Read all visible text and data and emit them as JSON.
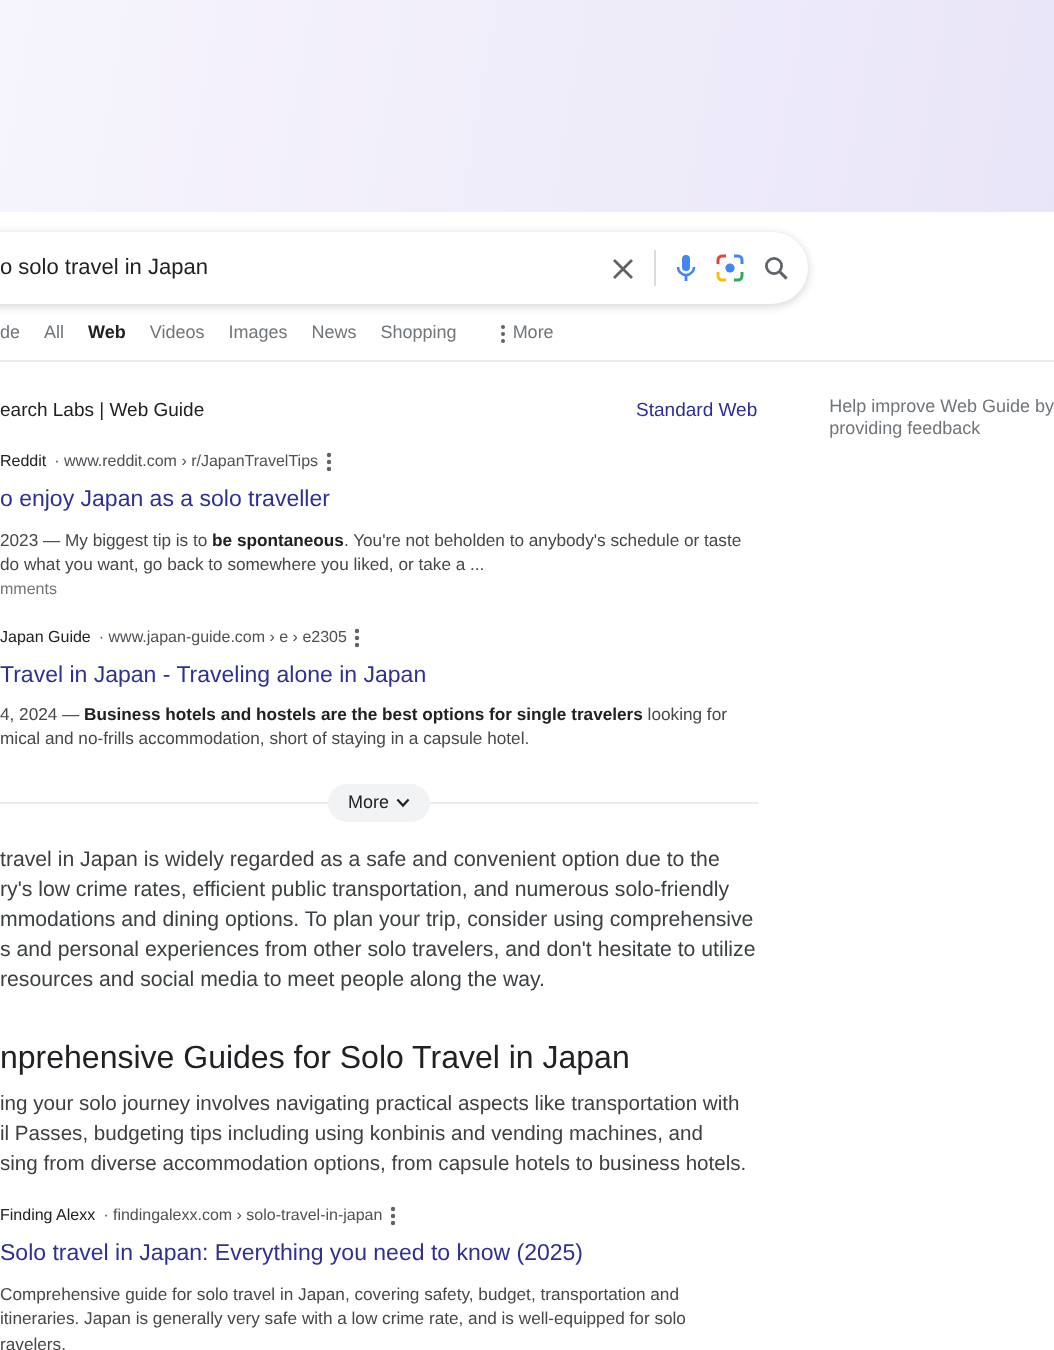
{
  "search": {
    "value": "o solo travel in Japan"
  },
  "tabs": [
    {
      "label": "de",
      "selected": false,
      "kind": "plain"
    },
    {
      "label": "All",
      "selected": false,
      "kind": "plain"
    },
    {
      "label": "Web",
      "selected": true,
      "kind": "plain"
    },
    {
      "label": "Videos",
      "selected": false,
      "kind": "plain"
    },
    {
      "label": "Images",
      "selected": false,
      "kind": "plain"
    },
    {
      "label": "News",
      "selected": false,
      "kind": "plain"
    },
    {
      "label": "Shopping",
      "selected": false,
      "kind": "plain"
    },
    {
      "label": "More",
      "selected": false,
      "kind": "menu"
    }
  ],
  "guide_header": {
    "title": "earch Labs | Web Guide",
    "link": "Standard Web",
    "feedback_lines": [
      "Help improve Web Guide by",
      "providing feedback"
    ]
  },
  "results": [
    {
      "site": "Reddit",
      "url": "· www.reddit.com › r/JapanTravelTips",
      "title": "o enjoy Japan as a solo traveller",
      "snippet_lines": [
        "2023 — My biggest tip is to **be spontaneous**. You're not beholden to anybody's schedule or taste",
        "do what you want, go back to somewhere you liked, or take a ..."
      ],
      "footer": "mments"
    },
    {
      "site": "Japan Guide",
      "url": "· www.japan-guide.com › e › e2305",
      "title": "Travel in Japan - Traveling alone in Japan",
      "snippet_lines": [
        "4, 2024 — **Business hotels and hostels are the best options for single travelers** looking for",
        "mical and no-frills accommodation, short of staying in a capsule hotel."
      ]
    }
  ],
  "more_button": {
    "label": "More"
  },
  "summary_lines": [
    "travel in Japan is widely regarded as a safe and convenient option due to the",
    "ry's low crime rates, efficient public transportation, and numerous solo-friendly",
    "mmodations and dining options. To plan your trip, consider using comprehensive",
    "s and personal experiences from other solo travelers, and don't hesitate to utilize",
    "resources and social media to meet people along the way."
  ],
  "section": {
    "heading": "nprehensive Guides for Solo Travel in Japan",
    "lines": [
      "ing your solo journey involves navigating practical aspects like transportation with",
      "il Passes, budgeting tips including using konbinis and vending machines, and",
      "sing from diverse accommodation options, from capsule hotels to business hotels."
    ],
    "results": [
      {
        "site": "Finding Alexx",
        "url": "· findingalexx.com › solo-travel-in-japan",
        "title": "Solo travel in Japan: Everything you need to know (2025)",
        "snippet_lines": [
          "Comprehensive guide for solo travel in Japan, covering safety, budget, transportation and",
          "itineraries. Japan is generally very safe with a low crime rate, and is well-equipped for solo",
          "ravelers."
        ]
      }
    ]
  }
}
